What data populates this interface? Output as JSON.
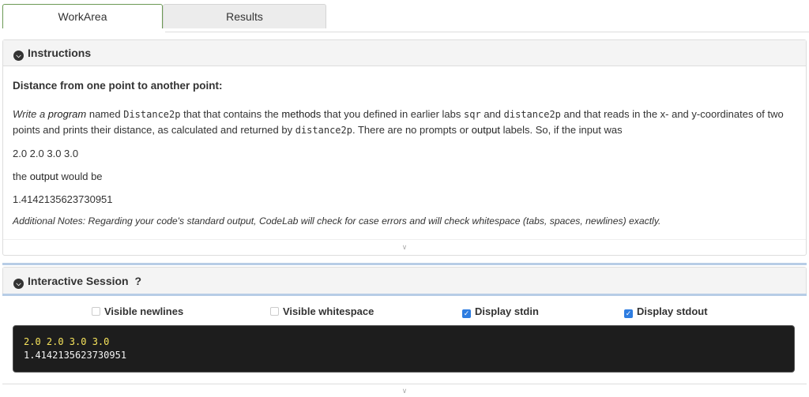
{
  "tabs": {
    "workarea": "WorkArea",
    "results": "Results"
  },
  "instructions": {
    "heading": "Instructions",
    "title": "Distance from one point to another point:",
    "p_write": "Write a",
    "p_program": "program",
    "p_named": "named",
    "p_name": "Distance2p",
    "p_that": "that that contains the",
    "p_methods": "methods",
    "p_defined": "that you defined in earlier labs",
    "p_sqr": "sqr",
    "p_and": "and",
    "p_dist": "distance2p",
    "p_reads": "and that reads in the x- and y-coordinates of two points and prints their distance, as calculated and returned by",
    "p_dist2": "distance2p",
    "p_noprompts": ". There are no prompts or",
    "p_output1": "output",
    "p_labels": "labels. So, if the input was",
    "input": "2.0 2.0 3.0 3.0",
    "the": "the",
    "output2": "output",
    "wouldbe": "would be",
    "result": "1.4142135623730951",
    "notes": "Additional Notes: Regarding your code's standard output, CodeLab will check for case errors and will check whitespace (tabs, spaces, newlines) exactly."
  },
  "session": {
    "heading": "Interactive Session",
    "help": "?",
    "options": {
      "newlines": "Visible newlines",
      "whitespace": "Visible whitespace",
      "stdin": "Display stdin",
      "stdout": "Display stdout"
    },
    "stdin_line": "2.0 2.0 3.0 3.0",
    "stdout_line": "1.4142135623730951"
  },
  "icons": {
    "collapse": "chevron-down-circle-icon",
    "expand": "double-chevron-down-icon",
    "check": "checkmark-icon"
  },
  "colors": {
    "accent": "#2e7de1",
    "active_tab_border": "#6c9a55",
    "stdin": "#f7e45c",
    "terminal_bg": "#1d1d1d"
  }
}
